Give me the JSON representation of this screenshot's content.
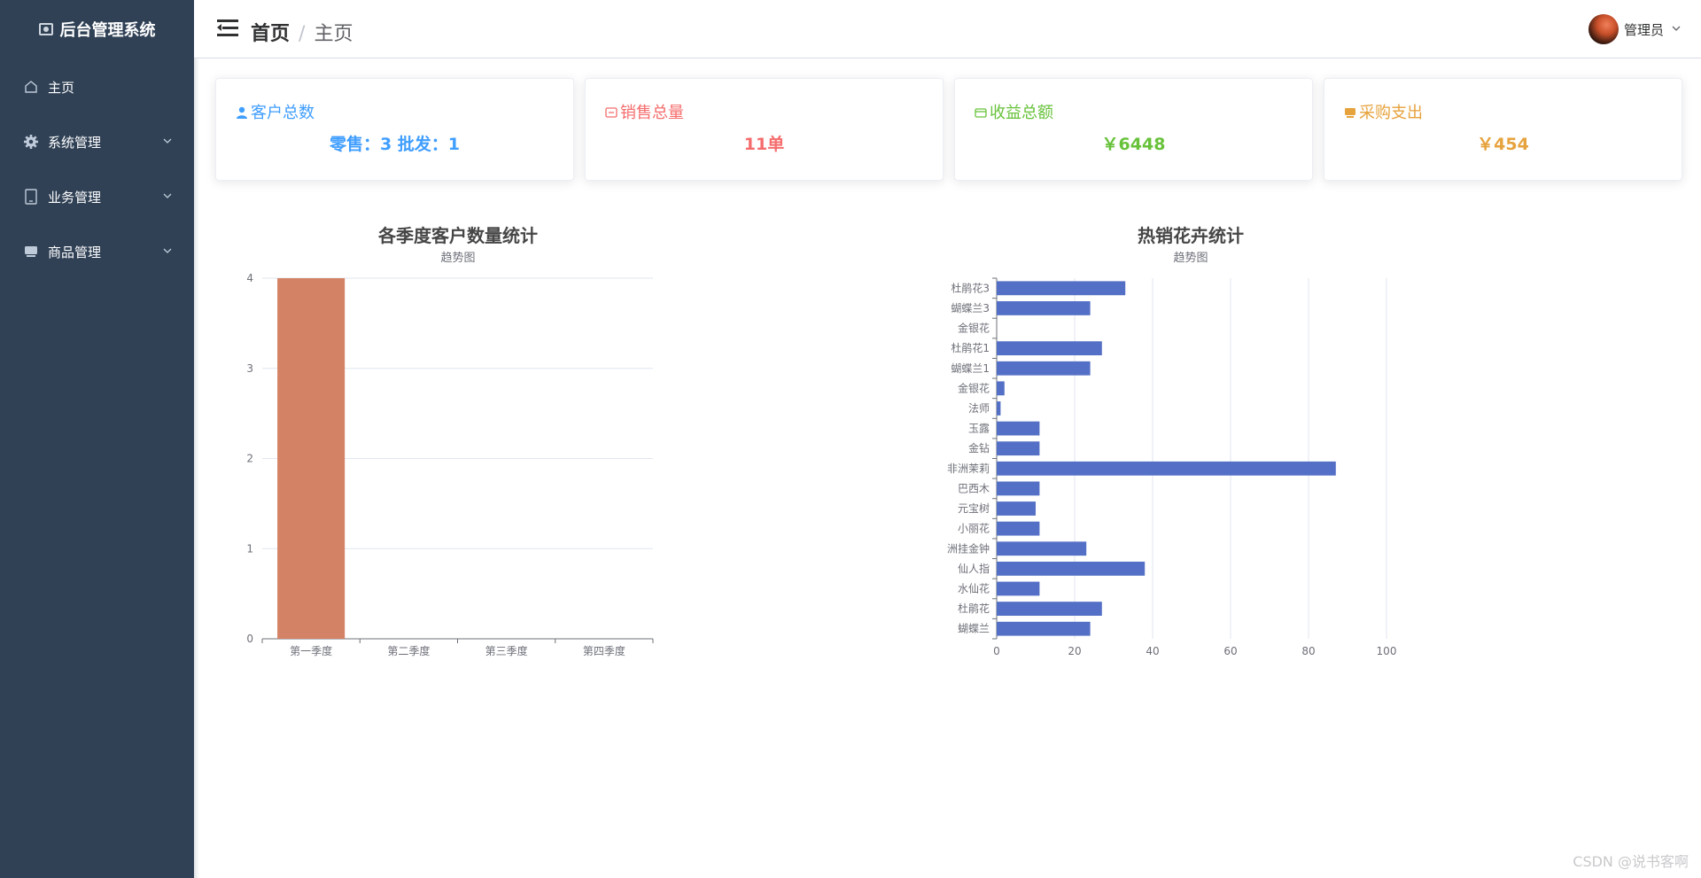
{
  "app": {
    "title": "后台管理系统"
  },
  "sidebar": {
    "items": [
      {
        "label": "主页",
        "icon": "home-icon",
        "expandable": false
      },
      {
        "label": "系统管理",
        "icon": "gear-icon",
        "expandable": true
      },
      {
        "label": "业务管理",
        "icon": "tablet-icon",
        "expandable": true
      },
      {
        "label": "商品管理",
        "icon": "goods-icon",
        "expandable": true
      }
    ]
  },
  "header": {
    "breadcrumb": [
      "首页",
      "主页"
    ],
    "separator": "/",
    "user": "管理员"
  },
  "cards": [
    {
      "title": "客户总数",
      "value": "零售：3 批发：1",
      "color": "#409eff",
      "icon": "user-icon"
    },
    {
      "title": "销售总量",
      "value": "11单",
      "color": "#f56c6c",
      "icon": "sales-icon"
    },
    {
      "title": "收益总额",
      "value": "￥6448",
      "color": "#67c23a",
      "icon": "wallet-icon"
    },
    {
      "title": "采购支出",
      "value": "￥454",
      "color": "#e6a23c",
      "icon": "purchase-icon"
    }
  ],
  "chart_data": [
    {
      "type": "bar",
      "title": "各季度客户数量统计",
      "subtitle": "趋势图",
      "categories": [
        "第一季度",
        "第二季度",
        "第三季度",
        "第四季度"
      ],
      "values": [
        4,
        0,
        0,
        0
      ],
      "ylim": [
        0,
        4
      ],
      "yticks": [
        0,
        1,
        2,
        3,
        4
      ],
      "grid": true,
      "color": "#d48265"
    },
    {
      "type": "bar",
      "orientation": "horizontal",
      "title": "热销花卉统计",
      "subtitle": "趋势图",
      "categories": [
        "蝴蝶兰",
        "杜鹃花",
        "水仙花",
        "仙人指",
        "洲挂金钟",
        "小丽花",
        "元宝树",
        "巴西木",
        "非洲茉莉",
        "金钻",
        "玉露",
        "法师",
        "金银花",
        "蝴蝶兰1",
        "杜鹃花1",
        "金银花",
        "蝴蝶兰3",
        "杜鹃花3"
      ],
      "values": [
        24,
        27,
        11,
        38,
        23,
        11,
        10,
        11,
        87,
        11,
        11,
        1,
        2,
        24,
        27,
        0,
        24,
        33
      ],
      "xlim": [
        0,
        100
      ],
      "xticks": [
        0,
        20,
        40,
        60,
        80,
        100
      ],
      "grid": true,
      "color": "#5470c6"
    }
  ],
  "watermark": "CSDN @说书客啊"
}
